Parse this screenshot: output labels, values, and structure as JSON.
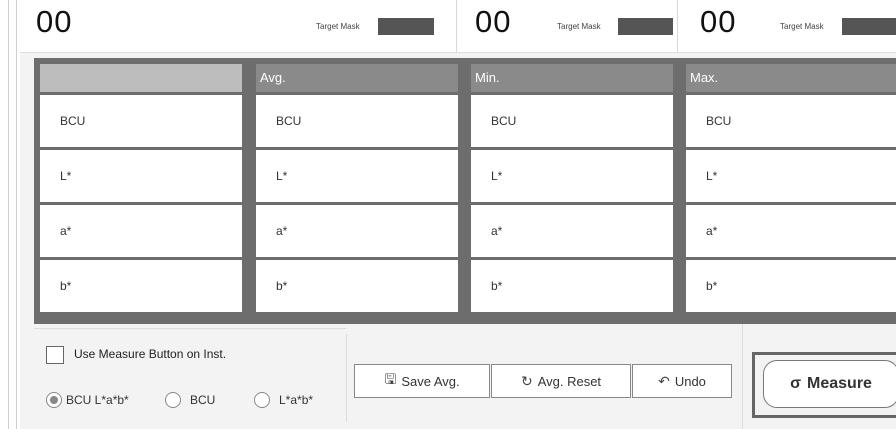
{
  "top": {
    "cells": [
      {
        "value": "00",
        "target_label": "Target Mask"
      },
      {
        "value": "00",
        "target_label": "Target Mask"
      },
      {
        "value": "00",
        "target_label": "Target Mask"
      }
    ]
  },
  "table": {
    "headers": [
      "",
      "Avg.",
      "Min.",
      "Max."
    ],
    "rows": [
      "BCU",
      "L*",
      "a*",
      "b*"
    ]
  },
  "controls": {
    "checkbox_label": "Use Measure Button on Inst.",
    "radios": [
      {
        "label": "BCU L*a*b*",
        "selected": true
      },
      {
        "label": "BCU",
        "selected": false
      },
      {
        "label": "L*a*b*",
        "selected": false
      }
    ],
    "buttons": {
      "save_avg": "Save Avg.",
      "avg_reset": "Avg. Reset",
      "undo": "Undo",
      "measure": "Measure"
    }
  }
}
